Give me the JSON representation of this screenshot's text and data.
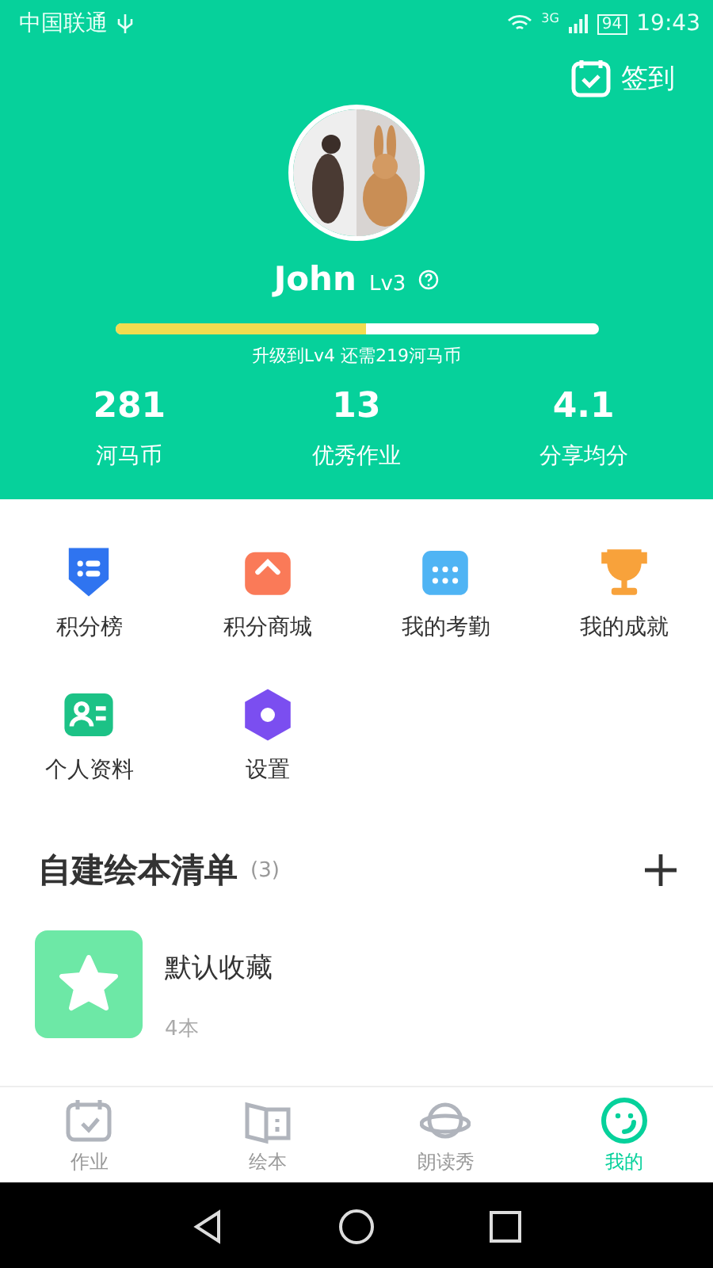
{
  "status_bar": {
    "carrier": "中国联通",
    "network": "3G",
    "battery": "94",
    "time": "19:43"
  },
  "header": {
    "checkin": "签到",
    "name": "John",
    "level": "Lv3",
    "progress": {
      "level": 0.52
    },
    "hint": "升级到Lv4 还需219河马币",
    "stats": [
      {
        "value": "281",
        "label": "河马币"
      },
      {
        "value": "13",
        "label": "优秀作业"
      },
      {
        "value": "4.1",
        "label": "分享均分"
      }
    ]
  },
  "menu": [
    {
      "label": "积分榜"
    },
    {
      "label": "积分商城"
    },
    {
      "label": "我的考勤"
    },
    {
      "label": "我的成就"
    },
    {
      "label": "个人资料"
    },
    {
      "label": "设置"
    }
  ],
  "section": {
    "title": "自建绘本清单",
    "count": "(3)"
  },
  "lists": [
    {
      "title": "默认收藏",
      "count": "4本"
    }
  ],
  "tabs": [
    {
      "label": "作业",
      "selected": false
    },
    {
      "label": "绘本",
      "selected": false
    },
    {
      "label": "朗读秀",
      "selected": false
    },
    {
      "label": "我的",
      "selected": true
    }
  ]
}
